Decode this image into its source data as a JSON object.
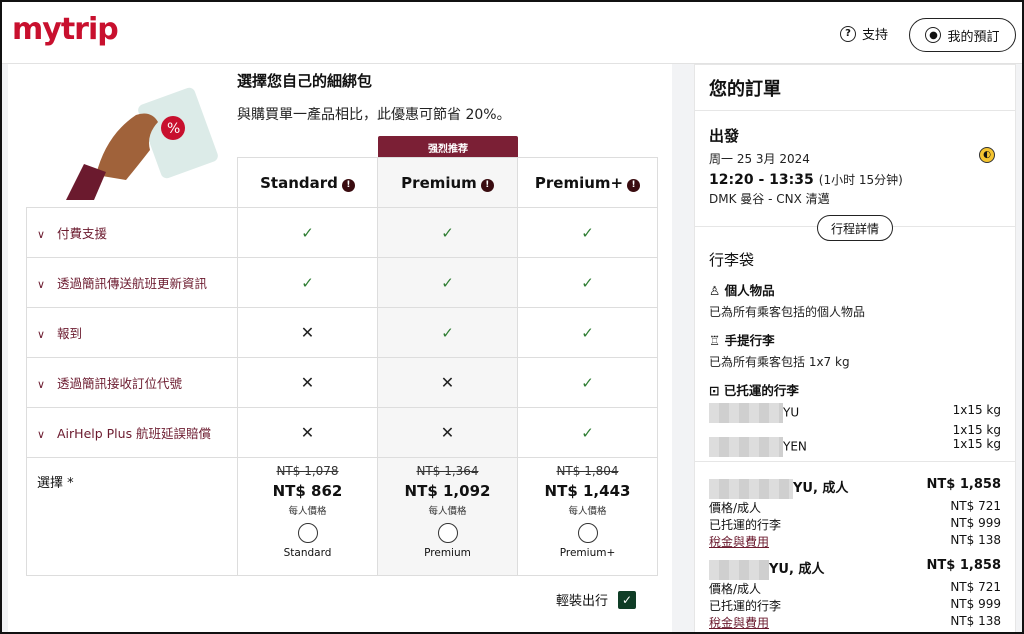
{
  "header": {
    "logo": "mytrip",
    "support_label": "支持",
    "my_booking_label": "我的預訂"
  },
  "bundle": {
    "title": "選擇您自己的細綁包",
    "subtitle": "與購買單一產品相比，此優惠可節省 20%。",
    "recommended_badge": "强烈推荐",
    "plans": [
      "Standard",
      "Premium",
      "Premium+"
    ],
    "features": [
      {
        "label": "付費支援",
        "values": [
          true,
          true,
          true
        ]
      },
      {
        "label": "透過簡訊傳送航班更新資訊",
        "values": [
          true,
          true,
          true
        ]
      },
      {
        "label": "報到",
        "values": [
          false,
          true,
          true
        ]
      },
      {
        "label": "透過簡訊接收訂位代號",
        "values": [
          false,
          false,
          true
        ]
      },
      {
        "label": "AirHelp Plus 航班延誤賠償",
        "values": [
          false,
          false,
          true
        ]
      }
    ],
    "select_label": "選擇 *",
    "prices": [
      {
        "old": "NT$ 1,078",
        "new": "NT$ 862",
        "per": "每人價格",
        "radio_label": "Standard"
      },
      {
        "old": "NT$ 1,364",
        "new": "NT$ 1,092",
        "per": "每人價格",
        "radio_label": "Premium"
      },
      {
        "old": "NT$ 1,804",
        "new": "NT$ 1,443",
        "per": "每人價格",
        "radio_label": "Premium+"
      }
    ],
    "light_travel_label": "輕裝出行"
  },
  "order": {
    "title": "您的訂單",
    "departure_label": "出發",
    "date": "周一 25 3月 2024",
    "time": "12:20 - 13:35",
    "duration": "(1小时 15分钟)",
    "route": "DMK 曼谷 - CNX 清邁",
    "route_details_button": "行程詳情",
    "bags_title": "行李袋",
    "personal_item_title": "個人物品",
    "personal_item_desc": "已為所有乘客包括的個人物品",
    "carry_on_title": "手提行李",
    "carry_on_desc": "已為所有乘客包括 1x7 kg",
    "checked_title": "已托運的行李",
    "checked_rows": [
      {
        "name": "YU",
        "weight": "1x15 kg"
      },
      {
        "name": "",
        "weight": "1x15 kg"
      },
      {
        "name": "YEN",
        "weight": "1x15 kg"
      }
    ],
    "passengers": [
      {
        "name": "YU, 成人",
        "total": "NT$ 1,858",
        "lines": [
          [
            "價格/成人",
            "NT$ 721"
          ],
          [
            "已托運的行李",
            "NT$ 999"
          ],
          [
            "稅金與費用",
            "NT$ 138"
          ]
        ]
      },
      {
        "name": "YU, 成人",
        "total": "NT$ 1,858",
        "lines": [
          [
            "價格/成人",
            "NT$ 721"
          ],
          [
            "已托運的行李",
            "NT$ 999"
          ],
          [
            "稅金與費用",
            "NT$ 138"
          ]
        ]
      }
    ]
  },
  "colors": {
    "brand": "#c8102e",
    "accent": "#7b1f35",
    "check": "#2e7d32"
  }
}
